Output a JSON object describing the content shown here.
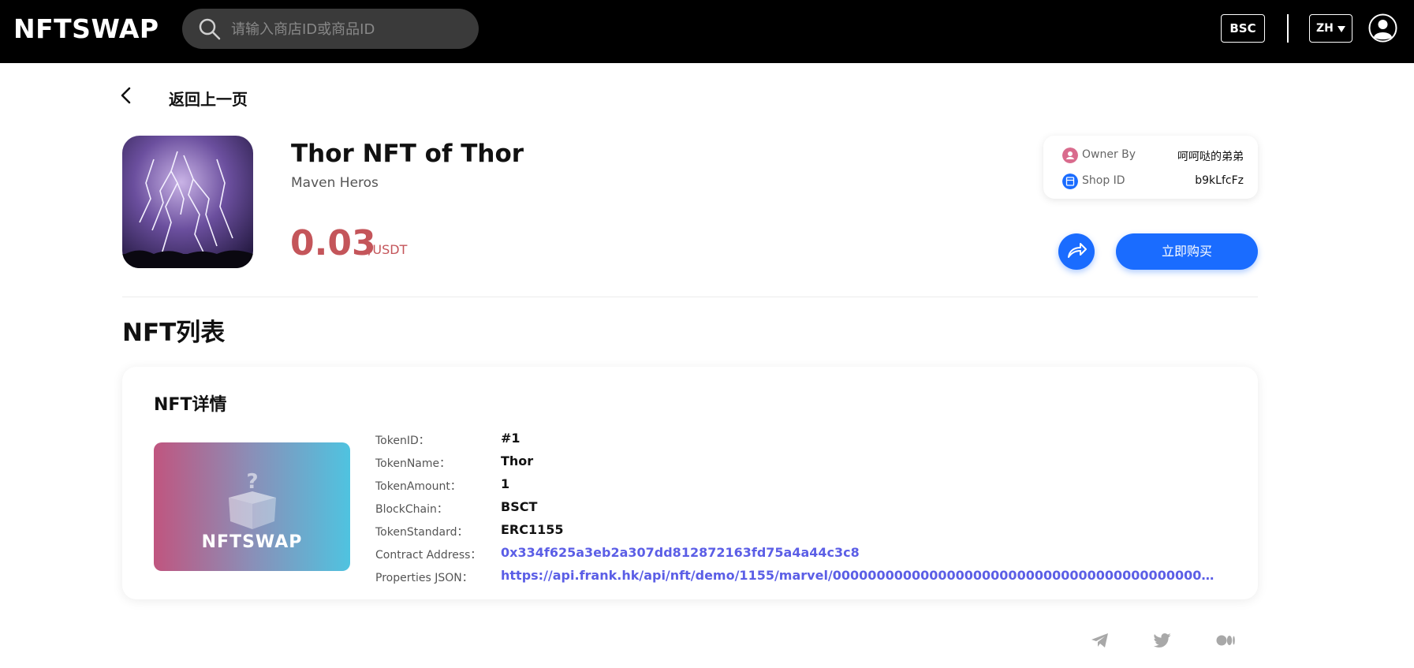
{
  "header": {
    "logo": "NFTSWAP",
    "search_placeholder": "请输入商店ID或商品ID",
    "chain_label": "BSC",
    "lang_label": "ZH"
  },
  "back": {
    "label": "返回上一页"
  },
  "product": {
    "title": "Thor NFT of Thor",
    "subtitle": "Maven Heros",
    "price": "0.03",
    "price_unit": "/USDT",
    "owner_label": "Owner By",
    "owner_value": "呵呵哒的弟弟",
    "shop_label": "Shop ID",
    "shop_value": "b9kLfcFz",
    "buy_label": "立即购买"
  },
  "nft_list": {
    "section_title": "NFT列表",
    "card_title": "NFT详情",
    "placeholder_brand": "NFTSWAP",
    "properties": [
      {
        "label": "TokenID：",
        "value": "#1"
      },
      {
        "label": "TokenName：",
        "value": "Thor"
      },
      {
        "label": "TokenAmount：",
        "value": "1"
      },
      {
        "label": "BlockChain：",
        "value": "BSCT"
      },
      {
        "label": "TokenStandard：",
        "value": "ERC1155"
      },
      {
        "label": "Contract Address：",
        "value": "0x334f625a3eb2a307dd812872163fd75a4a44c3c8"
      },
      {
        "label": "Properties JSON：",
        "value": "https://api.frank.hk/api/nft/demo/1155/marvel/000000000000000000000000000000000000000000000000000000..."
      }
    ]
  },
  "footer": {
    "social": [
      "telegram-icon",
      "twitter-icon",
      "medium-icon"
    ]
  },
  "colors": {
    "accent": "#1a6cff",
    "price": "#c4555a",
    "link": "#5b5ee6"
  }
}
